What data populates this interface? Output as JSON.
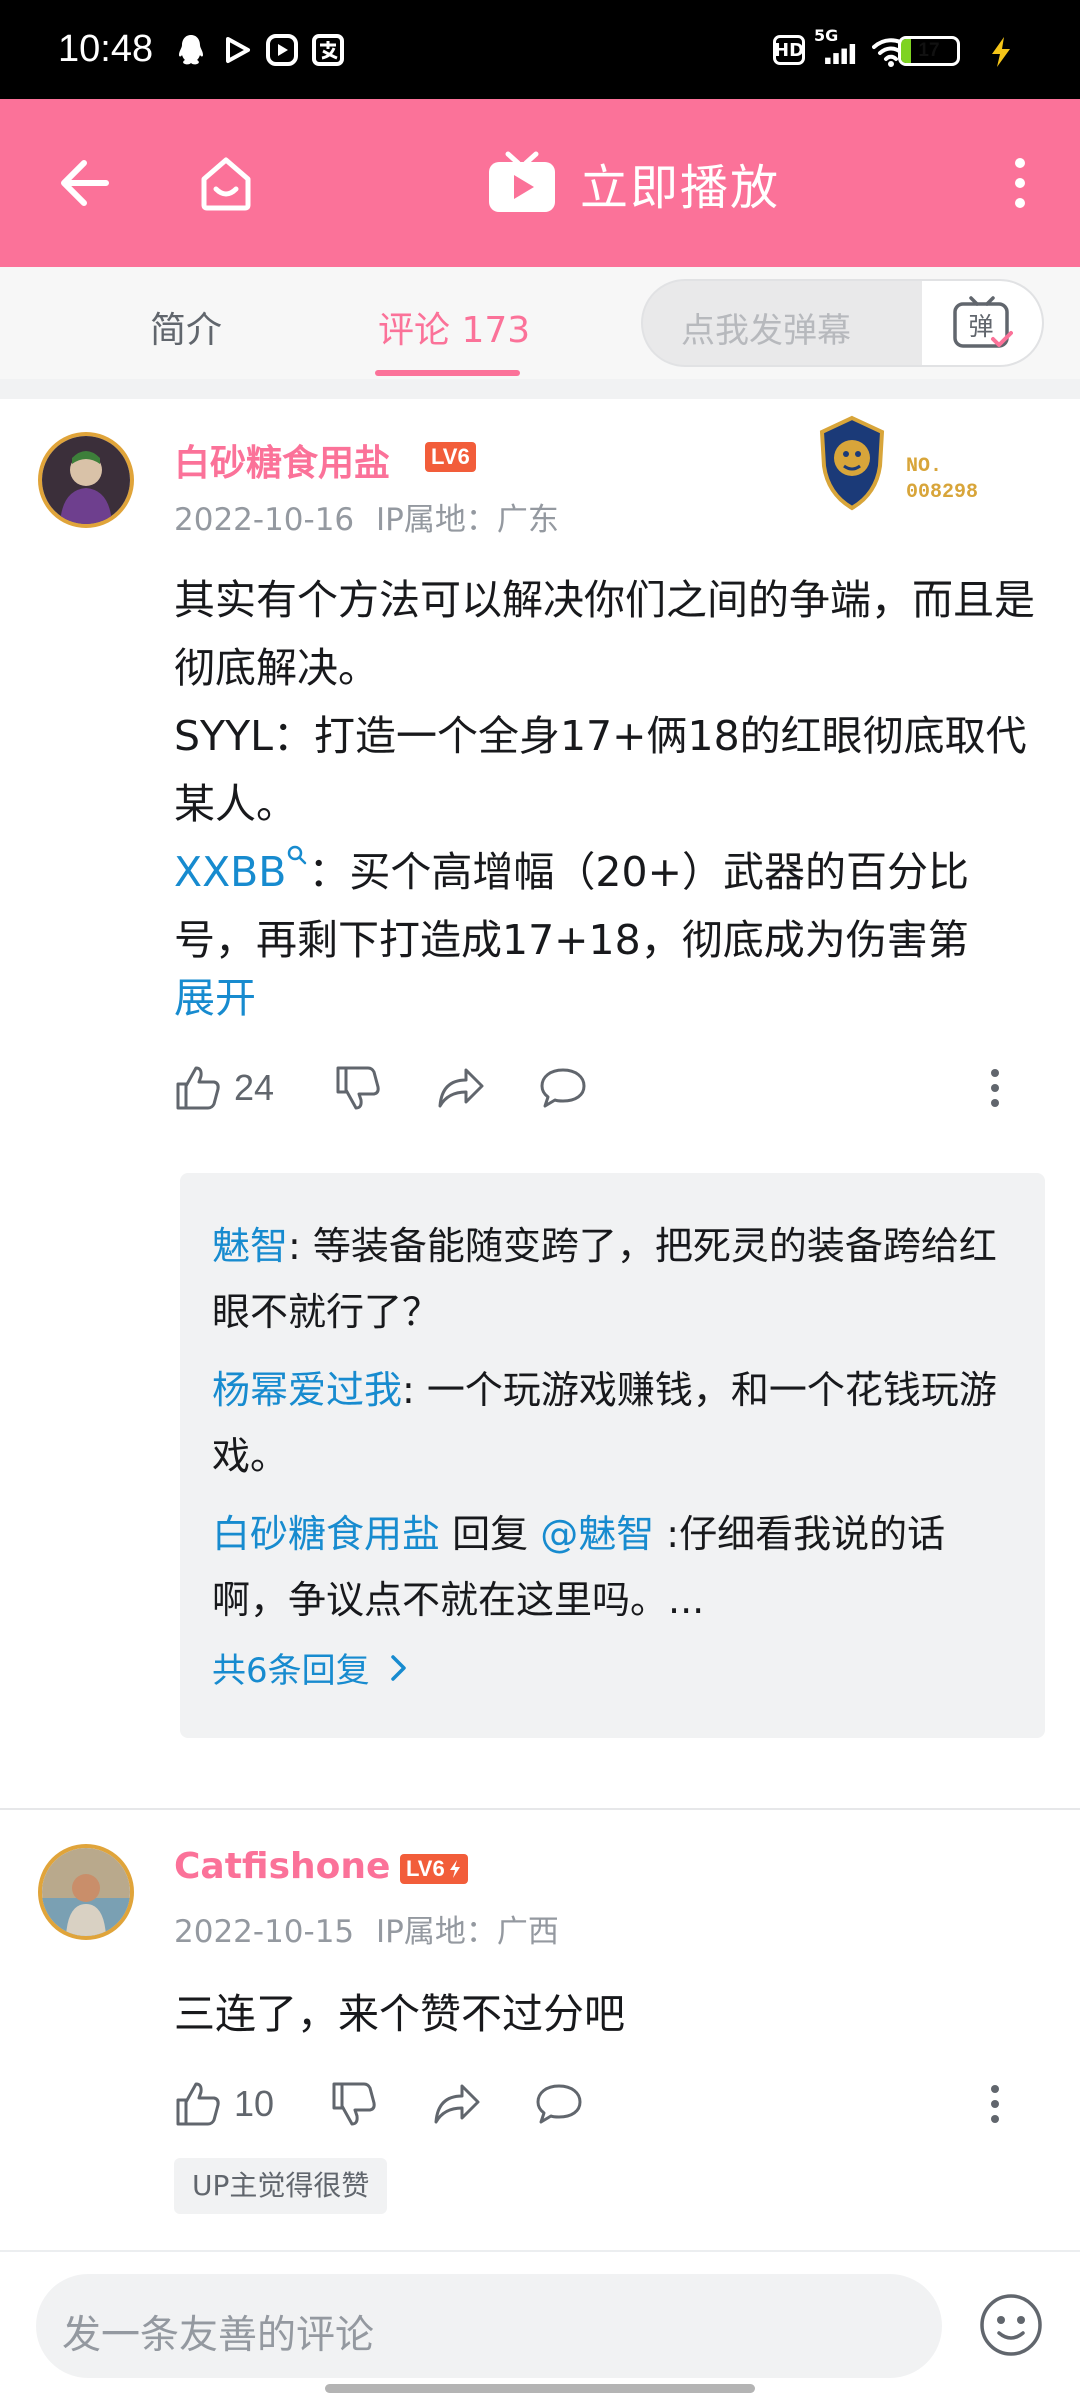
{
  "status_bar": {
    "time": "10:48",
    "hd": "HD",
    "network": "5G",
    "battery": "17",
    "battery_level": 0.17
  },
  "app_bar": {
    "play_now_label": "立即播放"
  },
  "tabs": {
    "intro": "简介",
    "comments": "评论 173"
  },
  "danmaku": {
    "placeholder": "点我发弹幕",
    "button_glyph": "弹"
  },
  "comments": [
    {
      "username": "白砂糖食用盐",
      "level": "LV6",
      "date": "2022-10-16",
      "ip": "IP属地：广东",
      "fan_badge_label": "NO.",
      "fan_badge_number": "008298",
      "text_p1": "其实有个方法可以解决你们之间的争端，而且是彻底解决。",
      "text_p2": "SYYL：打造一个全身17+俩18的红眼彻底取代某人。",
      "text_p3_link": "XXBB",
      "text_p3": "：买个高增幅（20+）武器的百分比号，再剩下打造成17+18，彻底成为伤害第",
      "expand": "展开",
      "likes": "24",
      "replies": [
        {
          "user": "魅智",
          "text": ": 等装备能随变跨了，把死灵的装备跨给红眼不就行了？"
        },
        {
          "user": "杨幂爱过我",
          "text": ": 一个玩游戏赚钱，和一个花钱玩游戏。"
        },
        {
          "user": "白砂糖食用盐",
          "reply_word": " 回复 ",
          "mention": "@魅智",
          "text": " :仔细看我说的话啊，争议点不就在这里吗。..."
        }
      ],
      "reply_total": "共6条回复"
    },
    {
      "username": "Catfishone",
      "level": "LV6",
      "date": "2022-10-15",
      "ip": "IP属地：广西",
      "text": "三连了，来个赞不过分吧",
      "likes": "10",
      "up_tag": "UP主觉得很赞"
    }
  ],
  "bottom": {
    "placeholder": "发一条友善的评论"
  },
  "colors": {
    "brand_pink": "#fb7299",
    "link_blue": "#178bcf",
    "level_badge": "#f25d3a"
  }
}
